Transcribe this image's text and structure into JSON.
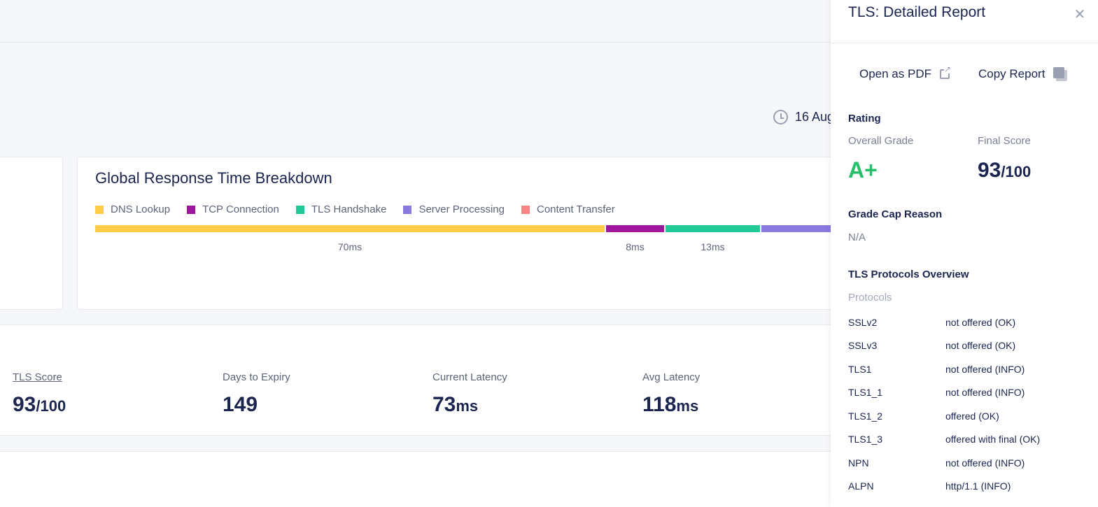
{
  "header": {
    "date_text": "16 Aug"
  },
  "breakdown": {
    "title": "Global Response Time Breakdown",
    "legend": [
      {
        "label": "DNS Lookup",
        "color": "#ffcd4a"
      },
      {
        "label": "TCP Connection",
        "color": "#a0179e"
      },
      {
        "label": "TLS Handshake",
        "color": "#22c996"
      },
      {
        "label": "Server Processing",
        "color": "#8a7ae0"
      },
      {
        "label": "Content Transfer",
        "color": "#f98585"
      }
    ],
    "segments": [
      {
        "name": "DNS Lookup",
        "ms": 70,
        "label": "70ms",
        "color": "#ffcd4a"
      },
      {
        "name": "TCP Connection",
        "ms": 8,
        "label": "8ms",
        "color": "#a0179e"
      },
      {
        "name": "TLS Handshake",
        "ms": 13,
        "label": "13ms",
        "color": "#22c996"
      },
      {
        "name": "Server Processing",
        "ms": 10,
        "label": "",
        "color": "#8a7ae0"
      }
    ]
  },
  "stats": [
    {
      "label": "TLS Score",
      "value": "93",
      "unit": "/100",
      "link": true
    },
    {
      "label": "Days to Expiry",
      "value": "149",
      "unit": "",
      "link": false
    },
    {
      "label": "Current Latency",
      "value": "73",
      "unit": "ms",
      "link": false
    },
    {
      "label": "Avg Latency",
      "value": "118",
      "unit": "ms",
      "link": false
    }
  ],
  "panel": {
    "title": "TLS: Detailed Report",
    "open_pdf": "Open as PDF",
    "copy_report": "Copy Report",
    "rating_heading": "Rating",
    "overall_grade_label": "Overall Grade",
    "overall_grade": "A+",
    "final_score_label": "Final Score",
    "final_score": "93",
    "final_score_unit": "/100",
    "grade_cap_heading": "Grade Cap Reason",
    "grade_cap_value": "N/A",
    "protocols_heading": "TLS Protocols Overview",
    "protocols_label": "Protocols",
    "protocols": [
      {
        "name": "SSLv2",
        "status": "not offered (OK)"
      },
      {
        "name": "SSLv3",
        "status": "not offered (OK)"
      },
      {
        "name": "TLS1",
        "status": "not offered (INFO)"
      },
      {
        "name": "TLS1_1",
        "status": "not offered (INFO)"
      },
      {
        "name": "TLS1_2",
        "status": "offered (OK)"
      },
      {
        "name": "TLS1_3",
        "status": "offered with final (OK)"
      },
      {
        "name": "NPN",
        "status": "not offered (INFO)"
      },
      {
        "name": "ALPN",
        "status": "http/1.1 (INFO)"
      }
    ]
  }
}
